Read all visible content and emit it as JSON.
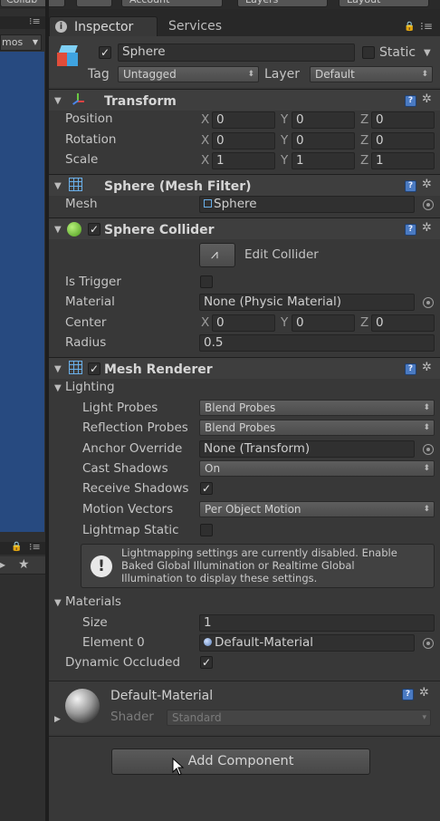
{
  "toolbar": {
    "collab": "Collab",
    "account": "Account",
    "layers": "Layers",
    "layout": "Layout"
  },
  "left_panel": {
    "gizmos": "mos"
  },
  "tabs": {
    "inspector": "Inspector",
    "services": "Services"
  },
  "object": {
    "name": "Sphere",
    "static_label": "Static",
    "tag_label": "Tag",
    "tag_value": "Untagged",
    "layer_label": "Layer",
    "layer_value": "Default"
  },
  "transform": {
    "title": "Transform",
    "position_label": "Position",
    "rotation_label": "Rotation",
    "scale_label": "Scale",
    "axis_x": "X",
    "axis_y": "Y",
    "axis_z": "Z",
    "position": [
      "0",
      "0",
      "0"
    ],
    "rotation": [
      "0",
      "0",
      "0"
    ],
    "scale": [
      "1",
      "1",
      "1"
    ]
  },
  "mesh_filter": {
    "title": "Sphere (Mesh Filter)",
    "mesh_label": "Mesh",
    "mesh_value": "Sphere"
  },
  "sphere_collider": {
    "title": "Sphere Collider",
    "edit_collider": "Edit Collider",
    "is_trigger_label": "Is Trigger",
    "material_label": "Material",
    "material_value": "None (Physic Material)",
    "center_label": "Center",
    "center": [
      "0",
      "0",
      "0"
    ],
    "radius_label": "Radius",
    "radius_value": "0.5"
  },
  "mesh_renderer": {
    "title": "Mesh Renderer",
    "lighting_label": "Lighting",
    "light_probes_label": "Light Probes",
    "light_probes_value": "Blend Probes",
    "reflection_probes_label": "Reflection Probes",
    "reflection_probes_value": "Blend Probes",
    "anchor_override_label": "Anchor Override",
    "anchor_override_value": "None (Transform)",
    "cast_shadows_label": "Cast Shadows",
    "cast_shadows_value": "On",
    "receive_shadows_label": "Receive Shadows",
    "motion_vectors_label": "Motion Vectors",
    "motion_vectors_value": "Per Object Motion",
    "lightmap_static_label": "Lightmap Static",
    "info_message": [
      "Lightmapping settings are currently disabled. Enable",
      "Baked Global Illumination or Realtime Global",
      "Illumination to display these settings."
    ],
    "materials_label": "Materials",
    "size_label": "Size",
    "size_value": "1",
    "element0_label": "Element 0",
    "element0_value": "Default-Material",
    "dynamic_occluded_label": "Dynamic Occluded"
  },
  "material": {
    "name": "Default-Material",
    "shader_label": "Shader",
    "shader_value": "Standard"
  },
  "add_component": "Add Component",
  "colors": {
    "bg": "#383838",
    "scene_blue": "#274a80",
    "help_blue": "#4a7ac2"
  }
}
